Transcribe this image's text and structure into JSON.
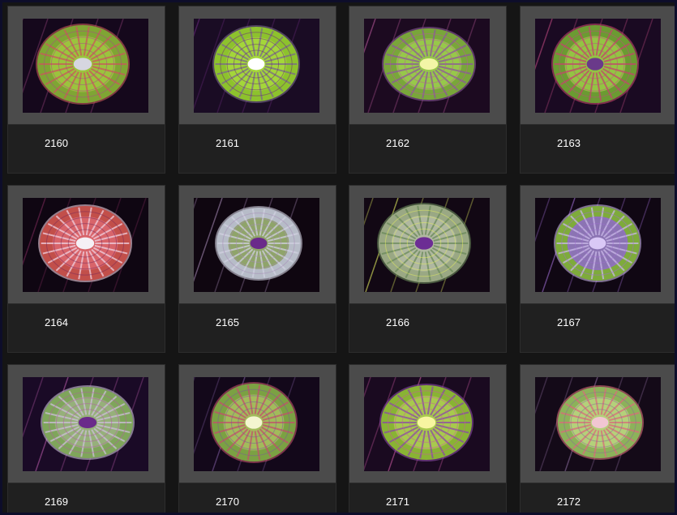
{
  "gallery": {
    "items": [
      {
        "id": "2160",
        "label": "2160",
        "colors": {
          "bg": "#15081c",
          "outer": "#7fa534",
          "inner": "#9bc43d",
          "rib": "#c85a5a",
          "center": "#d6d6e0",
          "accent": "#a84a8a"
        }
      },
      {
        "id": "2161",
        "label": "2161",
        "colors": {
          "bg": "#1a0c24",
          "outer": "#8dc22d",
          "inner": "#a4d63a",
          "rib": "#7a6a8a",
          "center": "#ffffff",
          "accent": "#6a2a7a"
        }
      },
      {
        "id": "2162",
        "label": "2162",
        "colors": {
          "bg": "#1c0a20",
          "outer": "#79a63a",
          "inner": "#97c84a",
          "rib": "#8a5a9a",
          "center": "#f3f5a6",
          "accent": "#b85a9a"
        }
      },
      {
        "id": "2163",
        "label": "2163",
        "colors": {
          "bg": "#1a0a22",
          "outer": "#6b9b32",
          "inner": "#93c443",
          "rib": "#c2456a",
          "center": "#6a3a8a",
          "accent": "#c04a82"
        }
      },
      {
        "id": "2164",
        "label": "2164",
        "colors": {
          "bg": "#0f0612",
          "outer": "#c24f4a",
          "inner": "#d8646a",
          "rib": "#f0d0e0",
          "center": "#f5f0f5",
          "accent": "#7a2a5a"
        }
      },
      {
        "id": "2165",
        "label": "2165",
        "colors": {
          "bg": "#0f0610",
          "outer": "#b7bcc8",
          "inner": "#8fa46a",
          "rib": "#d0d0e0",
          "center": "#6a2a8a",
          "accent": "#a58ab5"
        }
      },
      {
        "id": "2166",
        "label": "2166",
        "colors": {
          "bg": "#120814",
          "outer": "#9aa884",
          "inner": "#b0b8a0",
          "rib": "#6a8a5a",
          "center": "#6c2d94",
          "accent": "#e6f060"
        }
      },
      {
        "id": "2167",
        "label": "2167",
        "colors": {
          "bg": "#100713",
          "outer": "#7eab3b",
          "inner": "#8b74b3",
          "rib": "#c9b8e8",
          "center": "#d9c8f6",
          "accent": "#9d6dd0"
        }
      },
      {
        "id": "2169",
        "label": "2169",
        "colors": {
          "bg": "#1a0a26",
          "outer": "#7fa55b",
          "inner": "#96b07a",
          "rib": "#cbbfd8",
          "center": "#6a2a8a",
          "accent": "#b45aa5"
        }
      },
      {
        "id": "2170",
        "label": "2170",
        "colors": {
          "bg": "#13081a",
          "outer": "#7ba143",
          "inner": "#a2bb5b",
          "rib": "#c2506a",
          "center": "#f4f5d0",
          "accent": "#7a5a9a"
        }
      },
      {
        "id": "2171",
        "label": "2171",
        "colors": {
          "bg": "#1a0a20",
          "outer": "#89b334",
          "inner": "#a8c94d",
          "rib": "#8a4aa5",
          "center": "#f7f5a0",
          "accent": "#c85aa0"
        }
      },
      {
        "id": "2172",
        "label": "2172",
        "colors": {
          "bg": "#140a18",
          "outer": "#8cb25a",
          "inner": "#b4d17a",
          "rib": "#d86c7a",
          "center": "#f1c6d2",
          "accent": "#8a6a9a"
        }
      }
    ]
  }
}
